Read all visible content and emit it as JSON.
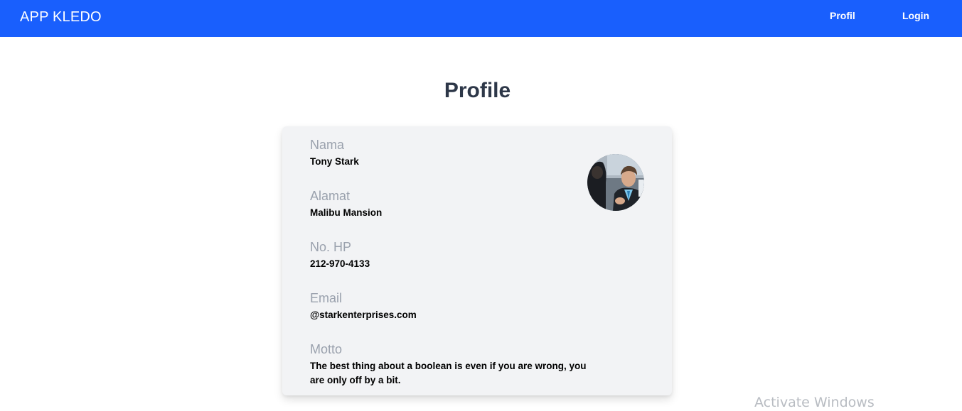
{
  "navbar": {
    "brand": "APP KLEDO",
    "links": [
      "Profil",
      "Login"
    ]
  },
  "page": {
    "title": "Profile"
  },
  "profile": {
    "fields": [
      {
        "label": "Nama",
        "value": "Tony Stark"
      },
      {
        "label": "Alamat",
        "value": "Malibu Mansion"
      },
      {
        "label": "No. HP",
        "value": "212-970-4133"
      },
      {
        "label": "Email",
        "value": "@starkenterprises.com"
      },
      {
        "label": "Motto",
        "value": "The best thing about a boolean is even if you are wrong, you are only off by a bit."
      }
    ],
    "avatar_icon": "profile-photo"
  },
  "watermark": "Activate Windows",
  "colors": {
    "navbar_bg": "#195ffd",
    "card_bg": "#f2f3f5",
    "label": "#9aa1ad",
    "title": "#2d3748"
  }
}
